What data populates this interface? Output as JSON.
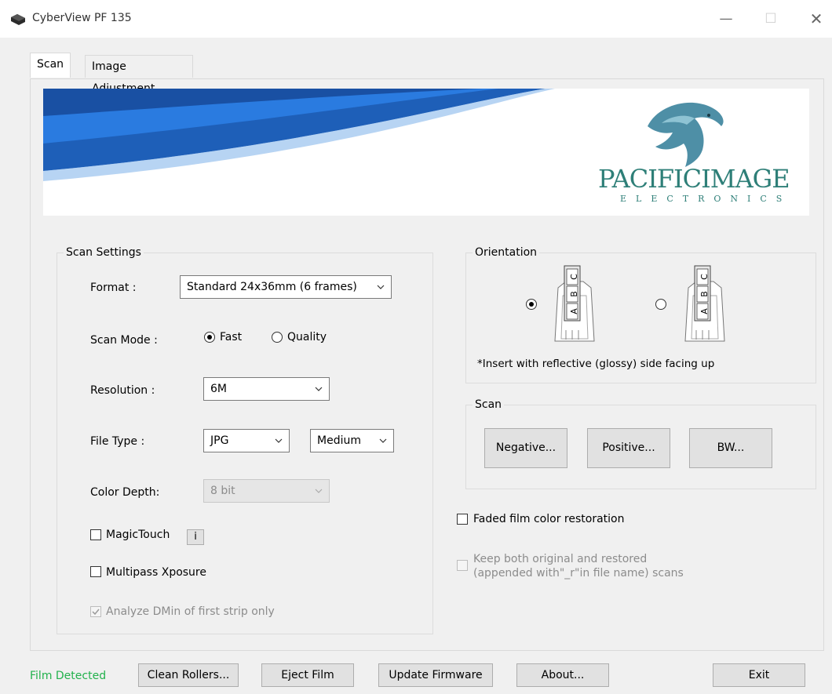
{
  "window": {
    "title": "CyberView PF 135",
    "minimize_icon": "minimize-icon",
    "maximize_icon": "maximize-icon",
    "close_icon": "close-icon",
    "minimize_glyph": "—",
    "maximize_glyph": "☐",
    "close_glyph": "✕"
  },
  "tabs": [
    {
      "label": "Scan",
      "active": true
    },
    {
      "label": "Image Adjustment",
      "active": false
    }
  ],
  "banner": {
    "logo_word_1": "PACIFIC",
    "logo_word_2": "IMAGE",
    "logo_sub": "ELECTRONICS"
  },
  "scan_settings": {
    "legend": "Scan Settings",
    "format": {
      "label": "Format :",
      "value": "Standard 24x36mm (6 frames)"
    },
    "scan_mode": {
      "label": "Scan Mode :",
      "options": [
        "Fast",
        "Quality"
      ],
      "selected": "Fast"
    },
    "resolution": {
      "label": "Resolution :",
      "value": "6M"
    },
    "file_type": {
      "label": "File Type :",
      "value": "JPG",
      "quality": "Medium"
    },
    "color_depth": {
      "label": "Color Depth:",
      "value": "8 bit",
      "enabled": false
    },
    "magictouch": {
      "label": "MagicTouch",
      "checked": false,
      "info": "i"
    },
    "multipass": {
      "label": "Multipass Xposure",
      "checked": false
    },
    "analyze_dmin": {
      "label": "Analyze DMin of first strip only",
      "checked": true,
      "enabled": false
    }
  },
  "orientation": {
    "legend": "Orientation",
    "selected": "left",
    "note": "*Insert with reflective (glossy) side facing up"
  },
  "scan": {
    "legend": "Scan",
    "negative": "Negative...",
    "positive": "Positive...",
    "bw": "BW..."
  },
  "faded": {
    "label": "Faded film color restoration",
    "checked": false
  },
  "keep_both": {
    "line1": "Keep both original and restored",
    "line2": "(appended with\"_r\"in file name) scans",
    "checked": false,
    "enabled": false
  },
  "footer": {
    "status": "Film Detected",
    "clean_rollers": "Clean Rollers...",
    "eject_film": "Eject Film",
    "update_firmware": "Update Firmware",
    "about": "About...",
    "exit": "Exit"
  },
  "colors": {
    "status_green": "#22b14c",
    "banner_blue": "#1565c0"
  }
}
